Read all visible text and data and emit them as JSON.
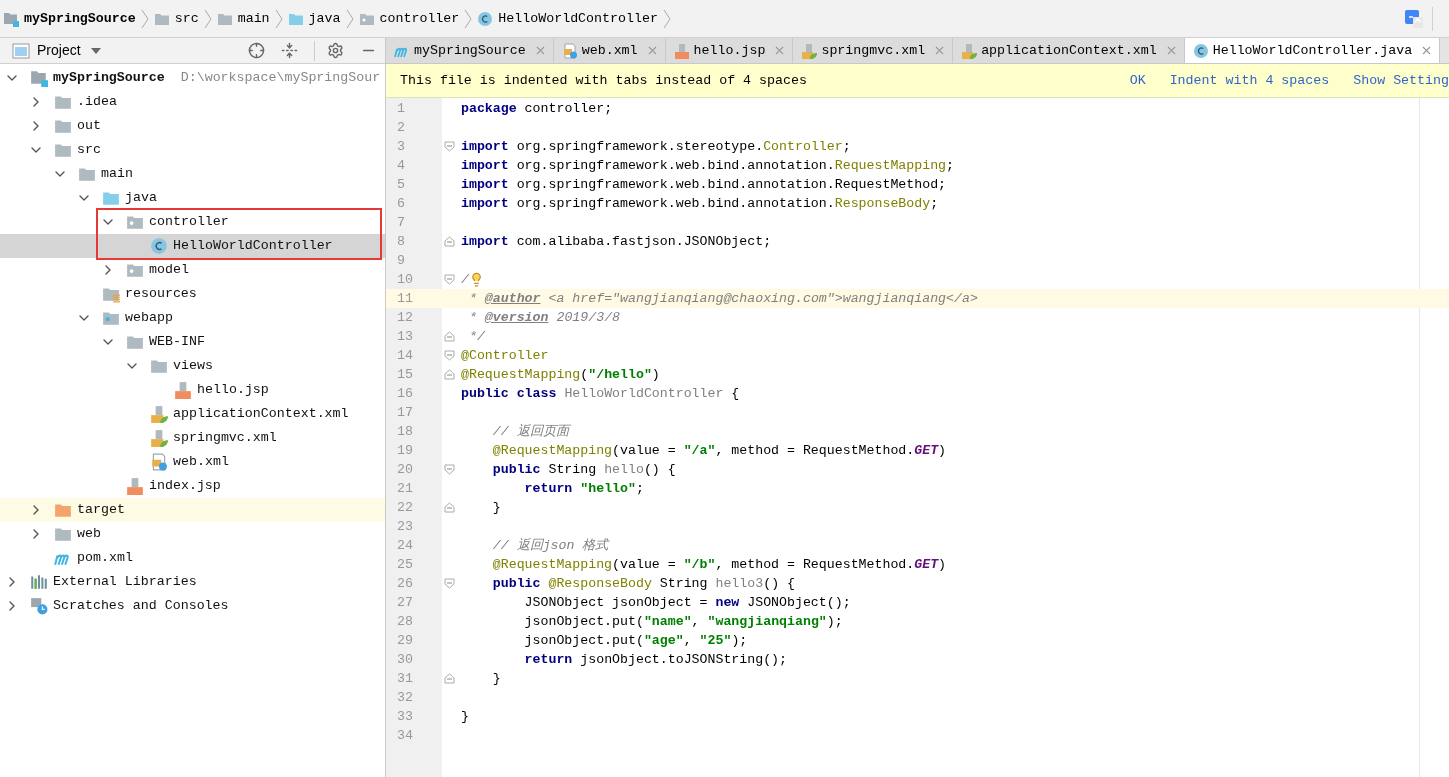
{
  "breadcrumbs": [
    {
      "label": "mySpringSource",
      "kind": "module"
    },
    {
      "label": "src",
      "kind": "folder"
    },
    {
      "label": "main",
      "kind": "folder"
    },
    {
      "label": "java",
      "kind": "source"
    },
    {
      "label": "controller",
      "kind": "package"
    },
    {
      "label": "HelloWorldController",
      "kind": "class"
    }
  ],
  "project_panel": {
    "title": "Project",
    "tree": [
      {
        "label": "mySpringSource",
        "kind": "module",
        "hint": "D:\\workspace\\mySpringSour",
        "expanded": true,
        "selected": false,
        "children": [
          {
            "label": ".idea",
            "kind": "folder",
            "expanded": false,
            "selected": false
          },
          {
            "label": "out",
            "kind": "folder",
            "expanded": false,
            "selected": false
          },
          {
            "label": "src",
            "kind": "folder",
            "expanded": true,
            "selected": false,
            "children": [
              {
                "label": "main",
                "kind": "folder",
                "expanded": true,
                "selected": false,
                "children": [
                  {
                    "label": "java",
                    "kind": "source",
                    "expanded": true,
                    "selected": false,
                    "children": [
                      {
                        "label": "controller",
                        "kind": "package",
                        "expanded": true,
                        "selected": false,
                        "children": [
                          {
                            "label": "HelloWorldController",
                            "kind": "class",
                            "selected": true
                          }
                        ]
                      },
                      {
                        "label": "model",
                        "kind": "package",
                        "expanded": false,
                        "selected": false
                      }
                    ]
                  },
                  {
                    "label": "resources",
                    "kind": "resources",
                    "selected": false
                  },
                  {
                    "label": "webapp",
                    "kind": "webapp",
                    "expanded": true,
                    "selected": false,
                    "children": [
                      {
                        "label": "WEB-INF",
                        "kind": "folder",
                        "expanded": true,
                        "selected": false,
                        "children": [
                          {
                            "label": "views",
                            "kind": "folder",
                            "expanded": true,
                            "selected": false,
                            "children": [
                              {
                                "label": "hello.jsp",
                                "kind": "jsp",
                                "selected": false
                              }
                            ]
                          },
                          {
                            "label": "applicationContext.xml",
                            "kind": "spring-xml",
                            "selected": false
                          },
                          {
                            "label": "springmvc.xml",
                            "kind": "spring-xml",
                            "selected": false
                          },
                          {
                            "label": "web.xml",
                            "kind": "web-xml",
                            "selected": false
                          }
                        ]
                      },
                      {
                        "label": "index.jsp",
                        "kind": "jsp",
                        "selected": false
                      }
                    ]
                  }
                ]
              }
            ]
          },
          {
            "label": "target",
            "kind": "excluded",
            "expanded": false,
            "selected": false
          },
          {
            "label": "web",
            "kind": "folder",
            "expanded": false,
            "selected": false
          },
          {
            "label": "pom.xml",
            "kind": "maven",
            "selected": false
          }
        ]
      },
      {
        "label": "External Libraries",
        "kind": "libraries",
        "expanded": false,
        "selected": false
      },
      {
        "label": "Scratches and Consoles",
        "kind": "scratches",
        "expanded": false,
        "selected": false
      }
    ]
  },
  "editor_tabs": [
    {
      "label": "mySpringSource",
      "kind": "maven",
      "selected": false
    },
    {
      "label": "web.xml",
      "kind": "web-xml",
      "selected": false
    },
    {
      "label": "hello.jsp",
      "kind": "jsp",
      "selected": false
    },
    {
      "label": "springmvc.xml",
      "kind": "spring-xml",
      "selected": false
    },
    {
      "label": "applicationContext.xml",
      "kind": "spring-xml",
      "selected": false
    },
    {
      "label": "HelloWorldController.java",
      "kind": "class",
      "selected": true
    }
  ],
  "notification": {
    "message": "This file is indented with tabs instead of 4 spaces",
    "actions": [
      "OK",
      "Indent with 4 spaces",
      "Show Setting"
    ]
  },
  "editor": {
    "lines": [
      {
        "number": "1",
        "current": false,
        "tokens": [
          {
            "kind": "kw",
            "text": "package"
          },
          {
            "kind": "plain",
            "text": " controller;"
          }
        ]
      },
      {
        "number": "2",
        "current": false
      },
      {
        "number": "3",
        "current": false,
        "fold_start": true,
        "tokens": [
          {
            "kind": "kw",
            "text": "import"
          },
          {
            "kind": "plain",
            "text": " org.springframework.stereotype."
          },
          {
            "kind": "ann",
            "text": "Controller"
          },
          {
            "kind": "plain",
            "text": ";"
          }
        ]
      },
      {
        "number": "4",
        "current": false,
        "tokens": [
          {
            "kind": "kw",
            "text": "import"
          },
          {
            "kind": "plain",
            "text": " org.springframework.web.bind.annotation."
          },
          {
            "kind": "ann",
            "text": "RequestMapping"
          },
          {
            "kind": "plain",
            "text": ";"
          }
        ]
      },
      {
        "number": "5",
        "current": false,
        "tokens": [
          {
            "kind": "kw",
            "text": "import"
          },
          {
            "kind": "plain",
            "text": " org.springframework.web.bind.annotation.RequestMethod;"
          }
        ]
      },
      {
        "number": "6",
        "current": false,
        "tokens": [
          {
            "kind": "kw",
            "text": "import"
          },
          {
            "kind": "plain",
            "text": " org.springframework.web.bind.annotation."
          },
          {
            "kind": "ann",
            "text": "ResponseBody"
          },
          {
            "kind": "plain",
            "text": ";"
          }
        ]
      },
      {
        "number": "7",
        "current": false
      },
      {
        "number": "8",
        "current": false,
        "fold_end": true,
        "tokens": [
          {
            "kind": "kw",
            "text": "import"
          },
          {
            "kind": "plain",
            "text": " com.alibaba.fastjson.JSONObject;"
          }
        ]
      },
      {
        "number": "9",
        "current": false
      },
      {
        "number": "10",
        "current": false,
        "fold_start": true,
        "bulb": true,
        "tokens": [
          {
            "kind": "doc",
            "text": "/"
          }
        ]
      },
      {
        "number": "11",
        "current": true,
        "tokens": [
          {
            "kind": "doc",
            "text": " * "
          },
          {
            "kind": "doctag",
            "text": "@author"
          },
          {
            "kind": "doc",
            "text": " <a href=\"wangjianqiang@chaoxing.com\">wangjianqiang</a>"
          }
        ]
      },
      {
        "number": "12",
        "current": false,
        "tokens": [
          {
            "kind": "doc",
            "text": " * "
          },
          {
            "kind": "doctag",
            "text": "@version"
          },
          {
            "kind": "doc",
            "text": " 2019/3/8"
          }
        ]
      },
      {
        "number": "13",
        "current": false,
        "fold_end": true,
        "tokens": [
          {
            "kind": "doc",
            "text": " */"
          }
        ]
      },
      {
        "number": "14",
        "current": false,
        "fold_start": true,
        "tokens": [
          {
            "kind": "ann",
            "text": "@Controller"
          }
        ]
      },
      {
        "number": "15",
        "current": false,
        "fold_end": true,
        "tokens": [
          {
            "kind": "ann",
            "text": "@RequestMapping"
          },
          {
            "kind": "plain",
            "text": "("
          },
          {
            "kind": "str",
            "text": "\"/hello\""
          },
          {
            "kind": "plain",
            "text": ")"
          }
        ]
      },
      {
        "number": "16",
        "current": false,
        "tokens": [
          {
            "kind": "kw",
            "text": "public class "
          },
          {
            "kind": "unused",
            "text": "HelloWorldController"
          },
          {
            "kind": "plain",
            "text": " {"
          }
        ]
      },
      {
        "number": "17",
        "current": false
      },
      {
        "number": "18",
        "current": false,
        "tokens": [
          {
            "kind": "cmt",
            "text": "    // 返回页面"
          }
        ]
      },
      {
        "number": "19",
        "current": false,
        "tokens": [
          {
            "kind": "ann",
            "text": "    @RequestMapping"
          },
          {
            "kind": "plain",
            "text": "(value = "
          },
          {
            "kind": "str",
            "text": "\"/a\""
          },
          {
            "kind": "plain",
            "text": ", method = RequestMethod."
          },
          {
            "kind": "const",
            "text": "GET"
          },
          {
            "kind": "plain",
            "text": ")"
          }
        ]
      },
      {
        "number": "20",
        "current": false,
        "fold_start": true,
        "tokens": [
          {
            "kind": "kw",
            "text": "    public"
          },
          {
            "kind": "plain",
            "text": " String "
          },
          {
            "kind": "unused",
            "text": "hello"
          },
          {
            "kind": "plain",
            "text": "() {"
          }
        ]
      },
      {
        "number": "21",
        "current": false,
        "tokens": [
          {
            "kind": "kw",
            "text": "        return "
          },
          {
            "kind": "str",
            "text": "\"hello\""
          },
          {
            "kind": "plain",
            "text": ";"
          }
        ]
      },
      {
        "number": "22",
        "current": false,
        "fold_end": true,
        "tokens": [
          {
            "kind": "plain",
            "text": "    }"
          }
        ]
      },
      {
        "number": "23",
        "current": false
      },
      {
        "number": "24",
        "current": false,
        "tokens": [
          {
            "kind": "cmt",
            "text": "    // 返回json 格式"
          }
        ]
      },
      {
        "number": "25",
        "current": false,
        "tokens": [
          {
            "kind": "ann",
            "text": "    @RequestMapping"
          },
          {
            "kind": "plain",
            "text": "(value = "
          },
          {
            "kind": "str",
            "text": "\"/b\""
          },
          {
            "kind": "plain",
            "text": ", method = RequestMethod."
          },
          {
            "kind": "const",
            "text": "GET"
          },
          {
            "kind": "plain",
            "text": ")"
          }
        ]
      },
      {
        "number": "26",
        "current": false,
        "fold_start": true,
        "tokens": [
          {
            "kind": "kw",
            "text": "    public "
          },
          {
            "kind": "ann",
            "text": "@ResponseBody"
          },
          {
            "kind": "plain",
            "text": " String "
          },
          {
            "kind": "unused",
            "text": "hello3"
          },
          {
            "kind": "plain",
            "text": "() {"
          }
        ]
      },
      {
        "number": "27",
        "current": false,
        "tokens": [
          {
            "kind": "plain",
            "text": "        JSONObject jsonObject = "
          },
          {
            "kind": "kw",
            "text": "new"
          },
          {
            "kind": "plain",
            "text": " JSONObject();"
          }
        ]
      },
      {
        "number": "28",
        "current": false,
        "tokens": [
          {
            "kind": "plain",
            "text": "        jsonObject.put("
          },
          {
            "kind": "str",
            "text": "\"name\""
          },
          {
            "kind": "plain",
            "text": ", "
          },
          {
            "kind": "str",
            "text": "\"wangjianqiang\""
          },
          {
            "kind": "plain",
            "text": ");"
          }
        ]
      },
      {
        "number": "29",
        "current": false,
        "tokens": [
          {
            "kind": "plain",
            "text": "        jsonObject.put("
          },
          {
            "kind": "str",
            "text": "\"age\""
          },
          {
            "kind": "plain",
            "text": ", "
          },
          {
            "kind": "str",
            "text": "\"25\""
          },
          {
            "kind": "plain",
            "text": ");"
          }
        ]
      },
      {
        "number": "30",
        "current": false,
        "tokens": [
          {
            "kind": "kw",
            "text": "        return"
          },
          {
            "kind": "plain",
            "text": " jsonObject.toJSONString();"
          }
        ]
      },
      {
        "number": "31",
        "current": false,
        "fold_end": true,
        "tokens": [
          {
            "kind": "plain",
            "text": "    }"
          }
        ]
      },
      {
        "number": "32",
        "current": false
      },
      {
        "number": "33",
        "current": false,
        "tokens": [
          {
            "kind": "plain",
            "text": "}"
          }
        ]
      },
      {
        "number": "34",
        "current": false
      }
    ]
  }
}
